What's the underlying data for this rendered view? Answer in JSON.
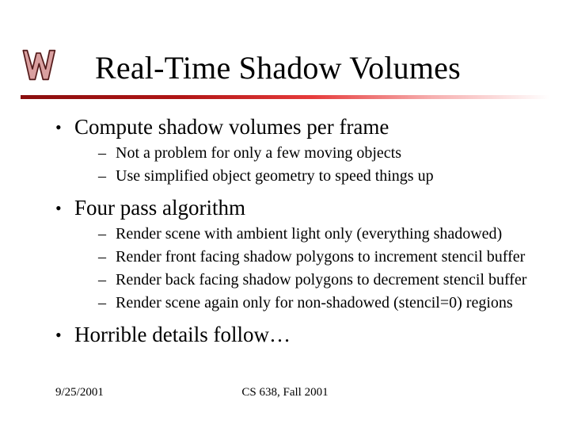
{
  "title": "Real-Time Shadow Volumes",
  "bullets": [
    {
      "text": "Compute shadow volumes per frame",
      "sub": [
        "Not a problem for only a few moving objects",
        "Use simplified object geometry to speed things up"
      ]
    },
    {
      "text": "Four pass algorithm",
      "sub": [
        "Render scene with ambient light only (everything shadowed)",
        "Render front facing shadow polygons to increment stencil buffer",
        "Render back facing shadow polygons to decrement stencil buffer",
        "Render scene again only for non-shadowed (stencil=0) regions"
      ]
    },
    {
      "text": "Horrible details follow…",
      "sub": []
    }
  ],
  "footer": {
    "date": "9/25/2001",
    "course": "CS 638, Fall 2001"
  },
  "logo": {
    "name": "wisconsin-w-logo"
  }
}
